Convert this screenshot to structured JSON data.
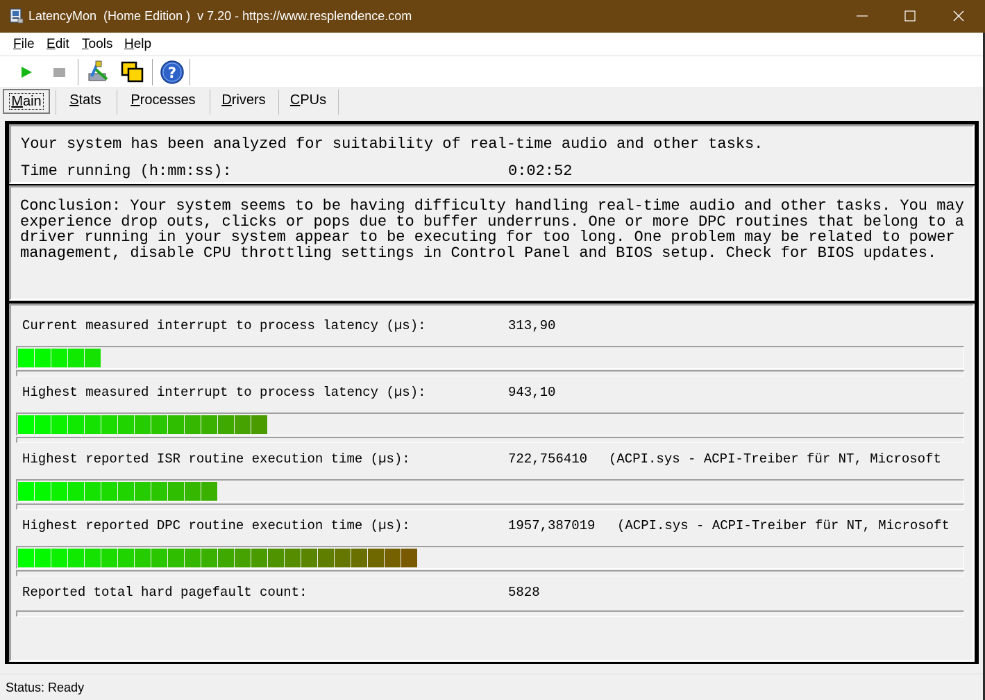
{
  "window": {
    "title": "LatencyMon  (Home Edition )  v 7.20 - https://www.resplendence.com"
  },
  "menu": {
    "items": [
      {
        "mnemonic": "F",
        "rest": "ile"
      },
      {
        "mnemonic": "E",
        "rest": "dit"
      },
      {
        "mnemonic": "T",
        "rest": "ools"
      },
      {
        "mnemonic": "H",
        "rest": "elp"
      }
    ]
  },
  "toolbar": {
    "buttons": [
      {
        "icon": "play-icon"
      },
      {
        "icon": "stop-icon"
      },
      {
        "icon": "tools-icon"
      },
      {
        "icon": "windows-icon"
      },
      {
        "icon": "help-icon"
      }
    ]
  },
  "tabs": [
    {
      "mnemonic": "M",
      "rest": "ain",
      "active": true
    },
    {
      "mnemonic": "S",
      "rest": "tats"
    },
    {
      "mnemonic": "P",
      "rest": "rocesses"
    },
    {
      "mnemonic": "D",
      "rest": "rivers"
    },
    {
      "mnemonic": "C",
      "rest": "PUs"
    }
  ],
  "summary": {
    "analyzed": "Your system has been analyzed for suitability of real-time audio and other tasks.",
    "time_label": "Time running (h:mm:ss):",
    "time_value": "0:02:52"
  },
  "conclusion": "Conclusion: Your system seems to be having difficulty handling real-time audio and other tasks. You may experience drop outs, clicks or pops due to buffer underruns. One or more DPC routines that belong to a driver running in your system appear to be executing for too long. One problem may be related to power management, disable CPU throttling settings in Control Panel and BIOS setup. Check for BIOS updates.",
  "metrics": [
    {
      "label": "Current measured interrupt to process latency (µs):",
      "value": "313,90",
      "extra": "",
      "segments": 5
    },
    {
      "label": "Highest measured interrupt to process latency (µs):",
      "value": "943,10",
      "extra": "",
      "segments": 15
    },
    {
      "label": "Highest reported ISR routine execution time (µs):",
      "value": "722,756410",
      "extra": "(ACPI.sys - ACPI-Treiber für NT, Microsoft",
      "segments": 12
    },
    {
      "label": "Highest reported DPC routine execution time (µs):",
      "value": "1957,387019",
      "extra": "(ACPI.sys - ACPI-Treiber für NT, Microsoft",
      "segments": 24
    },
    {
      "label": "Reported total hard pagefault count:",
      "value": "5828",
      "extra": ""
    }
  ],
  "statusbar": {
    "text": "Status: Ready"
  },
  "colors": {
    "titlebar": "#6a4512",
    "bar_green": "#00ff00",
    "bar_dark": "#7a5a00"
  }
}
